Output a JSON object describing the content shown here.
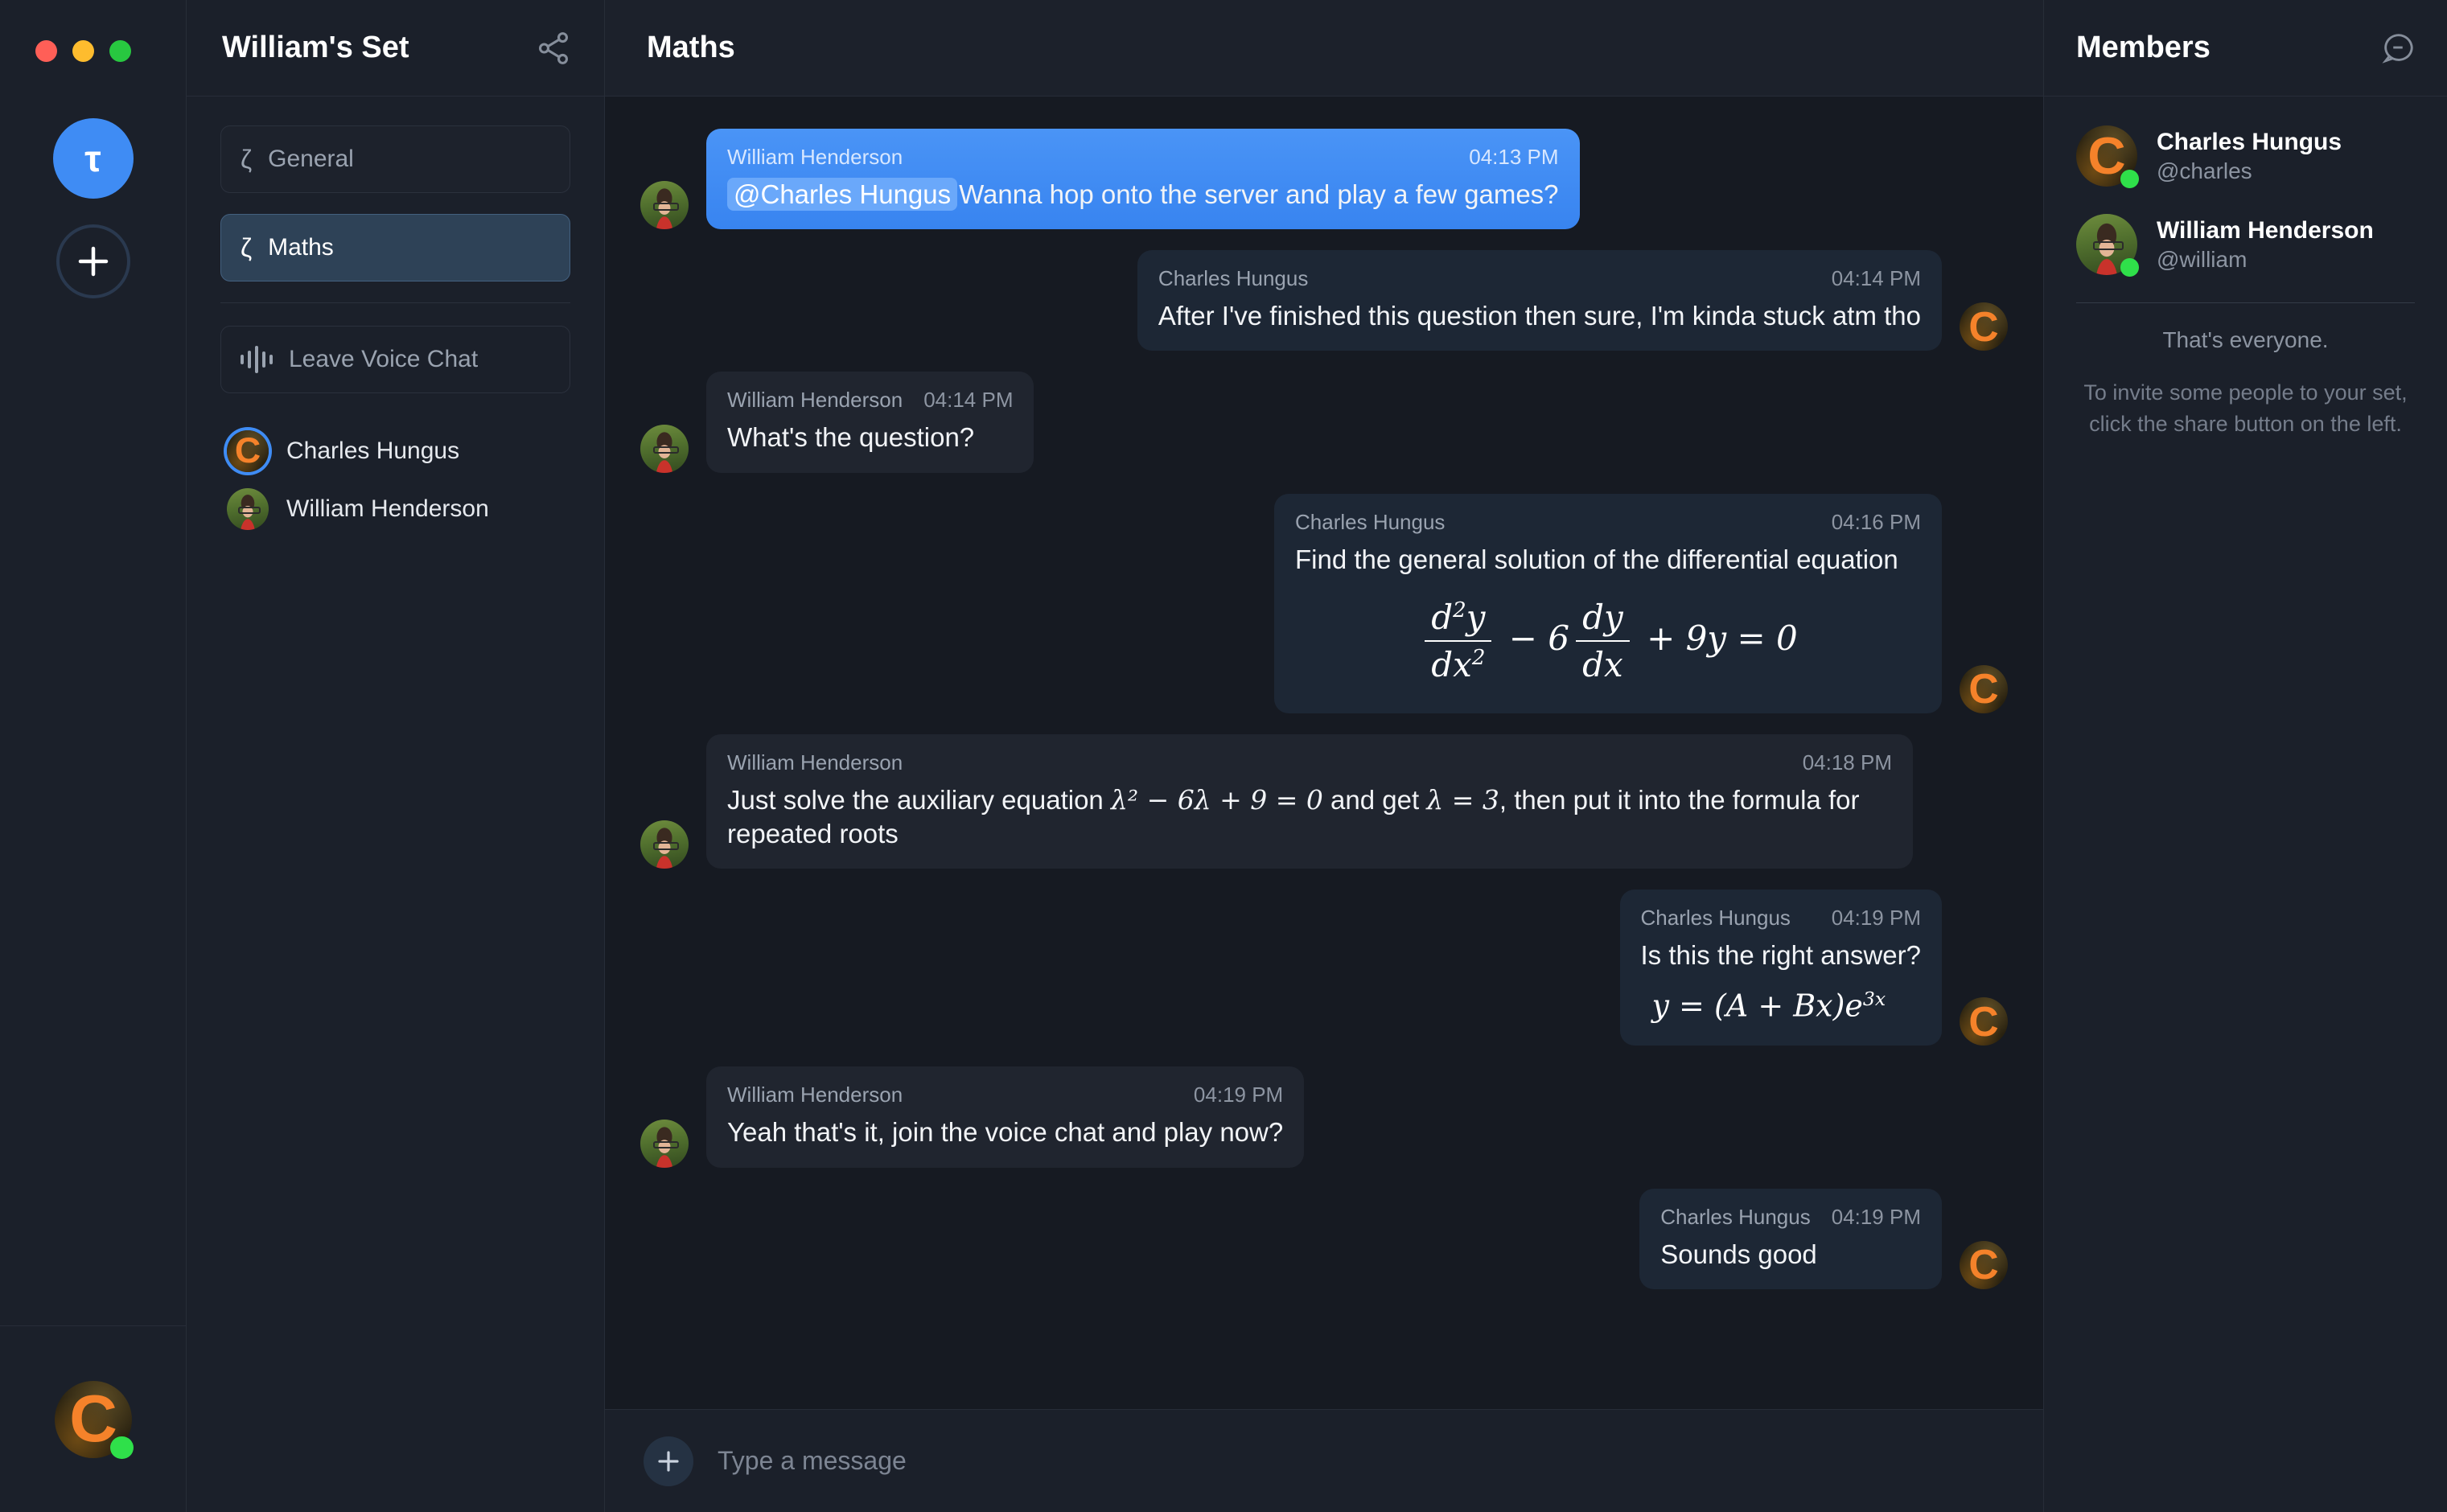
{
  "window": {
    "traffic_lights": [
      "close",
      "minimize",
      "zoom"
    ],
    "server_initial": "τ",
    "add_server_label": "+"
  },
  "sidebar": {
    "title": "William's Set",
    "share_icon": "share-icon",
    "channel_glyph": "ζ",
    "channels": [
      {
        "name": "General",
        "active": false
      },
      {
        "name": "Maths",
        "active": true
      }
    ],
    "voice": {
      "label": "Leave Voice Chat",
      "icon": "waveform-icon",
      "participants": [
        {
          "name": "Charles Hungus",
          "avatar": "c-logo",
          "speaking": true
        },
        {
          "name": "William Henderson",
          "avatar": "photo",
          "speaking": false
        }
      ]
    }
  },
  "chat": {
    "title": "Maths",
    "messages": [
      {
        "author": "William Henderson",
        "time": "04:13 PM",
        "side": "left",
        "avatar": "photo",
        "highlighted": true,
        "mention": "@Charles Hungus",
        "text": "Wanna hop onto the server and play a few games?"
      },
      {
        "author": "Charles Hungus",
        "time": "04:14 PM",
        "side": "right",
        "avatar": "c-logo",
        "text": "After I've finished this question then sure, I'm kinda stuck atm tho"
      },
      {
        "author": "William Henderson",
        "time": "04:14 PM",
        "side": "left",
        "avatar": "photo",
        "text": "What's the question?"
      },
      {
        "author": "Charles Hungus",
        "time": "04:16 PM",
        "side": "right",
        "avatar": "c-logo",
        "text": "Find the general solution of the differential equation",
        "math_block": "d²y/dx² − 6 dy/dx + 9y = 0"
      },
      {
        "author": "William Henderson",
        "time": "04:18 PM",
        "side": "left",
        "avatar": "photo",
        "text_parts": [
          "Just solve the auxiliary equation ",
          "λ² − 6λ + 9 = 0",
          " and get ",
          "λ = 3",
          ", then put it into the formula for repeated roots"
        ]
      },
      {
        "author": "Charles Hungus",
        "time": "04:19 PM",
        "side": "right",
        "avatar": "c-logo",
        "text": "Is this the right answer?",
        "math_block": "y = (A + Bx)e³ˣ"
      },
      {
        "author": "William Henderson",
        "time": "04:19 PM",
        "side": "left",
        "avatar": "photo",
        "text": "Yeah that's it, join the voice chat and play now?"
      },
      {
        "author": "Charles Hungus",
        "time": "04:19 PM",
        "side": "right",
        "avatar": "c-logo",
        "text": "Sounds good"
      }
    ],
    "composer": {
      "add_icon": "plus-icon",
      "placeholder": "Type a message",
      "value": ""
    }
  },
  "members": {
    "title": "Members",
    "collapse_icon": "chat-minus-icon",
    "list": [
      {
        "name": "Charles Hungus",
        "handle": "@charles",
        "avatar": "c-logo",
        "online": true
      },
      {
        "name": "William Henderson",
        "handle": "@william",
        "avatar": "photo",
        "online": true
      }
    ],
    "everyone_note": "That's everyone.",
    "invite_note": "To invite some people to your set, click the share button on the left."
  },
  "current_user": {
    "avatar": "c-logo",
    "online": true
  },
  "colors": {
    "accent_blue": "#3f8cf4",
    "mention_pill": "#6aa8fa",
    "online_green": "#2fe04a",
    "panel_bg": "#1b202a",
    "chat_bg": "#161a22",
    "bubble_left": "#20252f",
    "bubble_right": "#1d2735",
    "channel_active": "#2e4257",
    "avatar_orange": "#f5822a"
  }
}
